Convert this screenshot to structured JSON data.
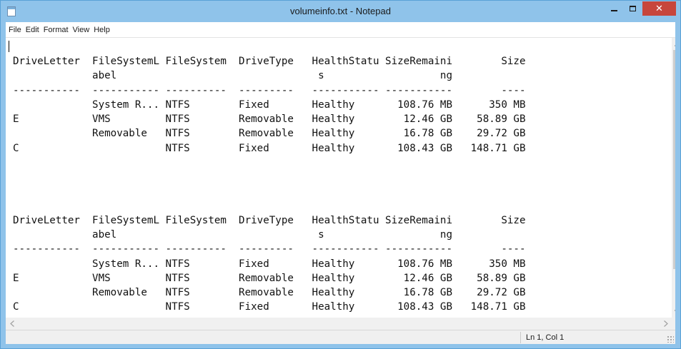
{
  "window": {
    "title": "volumeinfo.txt - Notepad",
    "close_symbol": "✕"
  },
  "menu": {
    "items": [
      "File",
      "Edit",
      "Format",
      "View",
      "Help"
    ]
  },
  "document": {
    "text": "DriveLetter  FileSystemL FileSystem  DriveType   HealthStatu SizeRemaini        Size\n             abel                                 s                   ng\n-----------  ----------- ----------  ---------   ----------- -----------        ----\n             System R... NTFS        Fixed       Healthy       108.76 MB      350 MB\nE            VMS         NTFS        Removable   Healthy        12.46 GB    58.89 GB\n             Removable   NTFS        Removable   Healthy        16.78 GB    29.72 GB\nC                        NTFS        Fixed       Healthy       108.43 GB   148.71 GB\n\n\n\n\nDriveLetter  FileSystemL FileSystem  DriveType   HealthStatu SizeRemaini        Size\n             abel                                 s                   ng\n-----------  ----------- ----------  ---------   ----------- -----------        ----\n             System R... NTFS        Fixed       Healthy       108.76 MB      350 MB\nE            VMS         NTFS        Removable   Healthy        12.46 GB    58.89 GB\n             Removable   NTFS        Removable   Healthy        16.78 GB    29.72 GB\nC                        NTFS        Fixed       Healthy       108.43 GB   148.71 GB"
  },
  "status": {
    "position": "Ln 1, Col 1"
  },
  "colors": {
    "titlebar": "#8fc3ea",
    "close_button": "#c7463c"
  },
  "icons": {
    "app": "notepad-icon",
    "minimize": "minimize-icon",
    "maximize": "maximize-icon",
    "close": "close-icon",
    "scroll_up": "chevron-up-icon",
    "scroll_down": "chevron-down-icon",
    "scroll_left": "chevron-left-icon",
    "scroll_right": "chevron-right-icon",
    "resize_grip": "resize-grip-icon"
  }
}
